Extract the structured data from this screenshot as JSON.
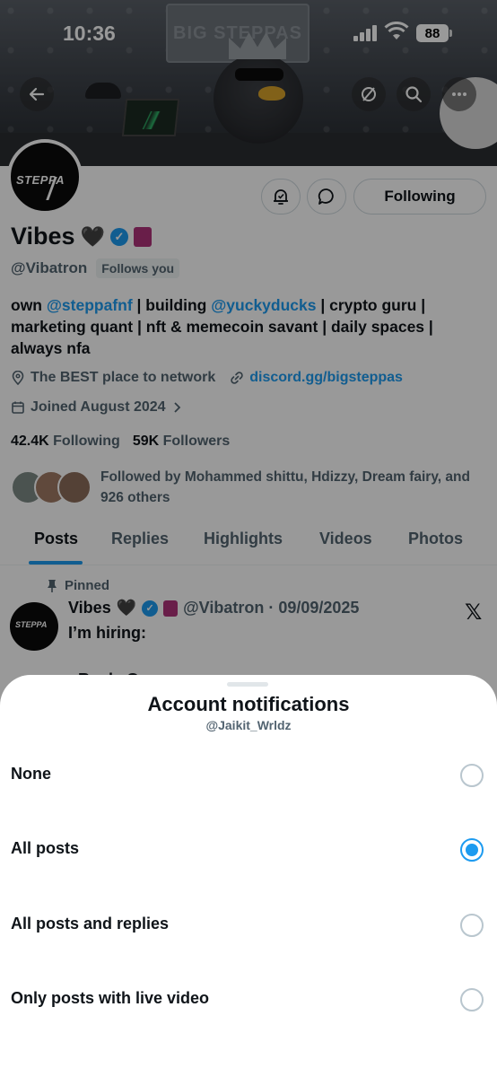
{
  "status_bar": {
    "time": "10:36",
    "battery": "88"
  },
  "banner": {
    "sign_text": "BIG STEPPAS"
  },
  "profile": {
    "avatar_text": "STEPPA",
    "name": "Vibes",
    "name_emoji": "🖤",
    "handle": "@Vibatron",
    "follows_you": "Follows you",
    "bio": {
      "part1": "own ",
      "link1": "@steppafnf",
      "part2": " | building ",
      "link2": "@yuckyducks",
      "part3": " | crypto guru | marketing quant | nft & memecoin savant | daily spaces | always nfa"
    },
    "location": "The BEST place to network",
    "website": "discord.gg/bigsteppas",
    "joined": "Joined August 2024",
    "following_count": "42.4K",
    "following_label": "Following",
    "followers_count": "59K",
    "followers_label": "Followers",
    "followed_by": "Followed by Mohammed shittu, Hdizzy, Dream fairy, and 926 others"
  },
  "actions": {
    "following_label": "Following"
  },
  "tabs": [
    {
      "label": "Posts"
    },
    {
      "label": "Replies"
    },
    {
      "label": "Highlights"
    },
    {
      "label": "Videos"
    },
    {
      "label": "Photos"
    }
  ],
  "pinned_post": {
    "pinned_label": "Pinned",
    "avatar_text": "STEPPA",
    "author_name": "Vibes",
    "author_emoji": "🖤",
    "handle_date": "@Vibatron · 09/09/2025",
    "text": "I’m hiring:\n\n- Reply Guys"
  },
  "sheet": {
    "title": "Account notifications",
    "subtitle": "@Jaikit_Wrldz",
    "options": [
      {
        "label": "None",
        "selected": false
      },
      {
        "label": "All posts",
        "selected": true
      },
      {
        "label": "All posts and replies",
        "selected": false
      },
      {
        "label": "Only posts with live video",
        "selected": false
      }
    ]
  },
  "colors": {
    "accent": "#1d9bf0",
    "text": "#0f1419",
    "secondary": "#536471"
  },
  "icons": [
    "back-arrow-icon",
    "grok-icon",
    "search-icon",
    "more-icon",
    "bell-icon",
    "message-icon",
    "verified-icon",
    "location-icon",
    "link-icon",
    "calendar-icon",
    "chevron-right-icon",
    "pin-icon",
    "x-logo-icon"
  ]
}
